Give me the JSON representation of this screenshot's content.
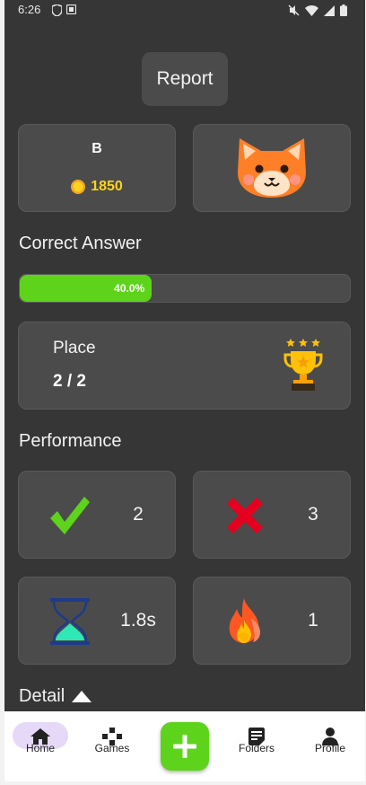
{
  "status_bar": {
    "time": "6:26"
  },
  "header": {
    "report_label": "Report"
  },
  "user": {
    "initial": "B",
    "coins": "1850"
  },
  "correct_answer": {
    "title": "Correct Answer",
    "progress_label": "40.0%",
    "progress_fraction": 0.4
  },
  "place": {
    "label": "Place",
    "value": "2 / 2"
  },
  "performance": {
    "title": "Performance",
    "correct": "2",
    "wrong": "3",
    "avg_time": "1.8s",
    "streak": "1"
  },
  "detail": {
    "label": "Detail"
  },
  "nav": {
    "items": [
      {
        "label": "Home",
        "icon": "home-icon"
      },
      {
        "label": "Games",
        "icon": "gamepad-icon"
      },
      {
        "label": "Folders",
        "icon": "folder-icon"
      },
      {
        "label": "Profile",
        "icon": "person-icon"
      }
    ]
  },
  "colors": {
    "accent": "#5ed31b",
    "coin": "#ffd21f",
    "background": "#363636",
    "card": "#4b4b4b"
  }
}
